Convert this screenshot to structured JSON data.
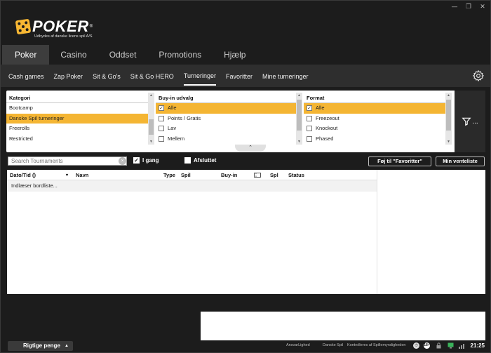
{
  "window": {
    "min": "—",
    "restore": "❐",
    "close": "✕"
  },
  "logo": {
    "word": "POKER",
    "reg": "®",
    "subtitle": "Udbydes af danske licens spil A/S"
  },
  "main_nav": [
    "Poker",
    "Casino",
    "Oddset",
    "Promotions",
    "Hjælp"
  ],
  "sub_nav": [
    "Cash games",
    "Zap Poker",
    "Sit & Go's",
    "Sit & Go HERO",
    "Turneringer",
    "Favoritter",
    "Mine turneringer"
  ],
  "filters": {
    "kategori": {
      "header": "Kategori",
      "items": [
        "Bootcamp",
        "Danske Spil turneringer",
        "Freerolls",
        "Restricted"
      ]
    },
    "buyin": {
      "header": "Buy-in udvalg",
      "items": [
        "Alle",
        "Points / Gratis",
        "Lav",
        "Mellem"
      ]
    },
    "format": {
      "header": "Format",
      "items": [
        "Alle",
        "Freezeout",
        "Knockout",
        "Phased"
      ]
    },
    "collapse_glyph": "⌃",
    "filter_label": "..."
  },
  "toolbar": {
    "search_placeholder": "Search Tournaments",
    "clear_glyph": "×",
    "i_gang": "I gang",
    "afsluttet": "Afsluttet",
    "add_fav": "Føj til \"Favoritter\"",
    "waitlist": "Min venteliste",
    "check_glyph": "✓"
  },
  "table": {
    "headers": {
      "date": "Dato/Tid ()",
      "sort": "▾",
      "name": "Navn",
      "type": "Type",
      "game": "Spil",
      "buyin": "Buy-in",
      "players": "Spl",
      "status": "Status"
    },
    "loading": "Indlæser bordliste..."
  },
  "footer": {
    "money": "Rigtige penge",
    "caret": "▲",
    "ansvarlighed": "AnsvarLighed",
    "danske_spil": "Danske Spil",
    "kontrolleres": "Kontrolleres af Spillemyndigheden",
    "age": "18+",
    "time": "21:25"
  },
  "colors": {
    "accent": "#f4b533",
    "bg": "#1c1c1c",
    "subnav": "#2e2e2e"
  }
}
